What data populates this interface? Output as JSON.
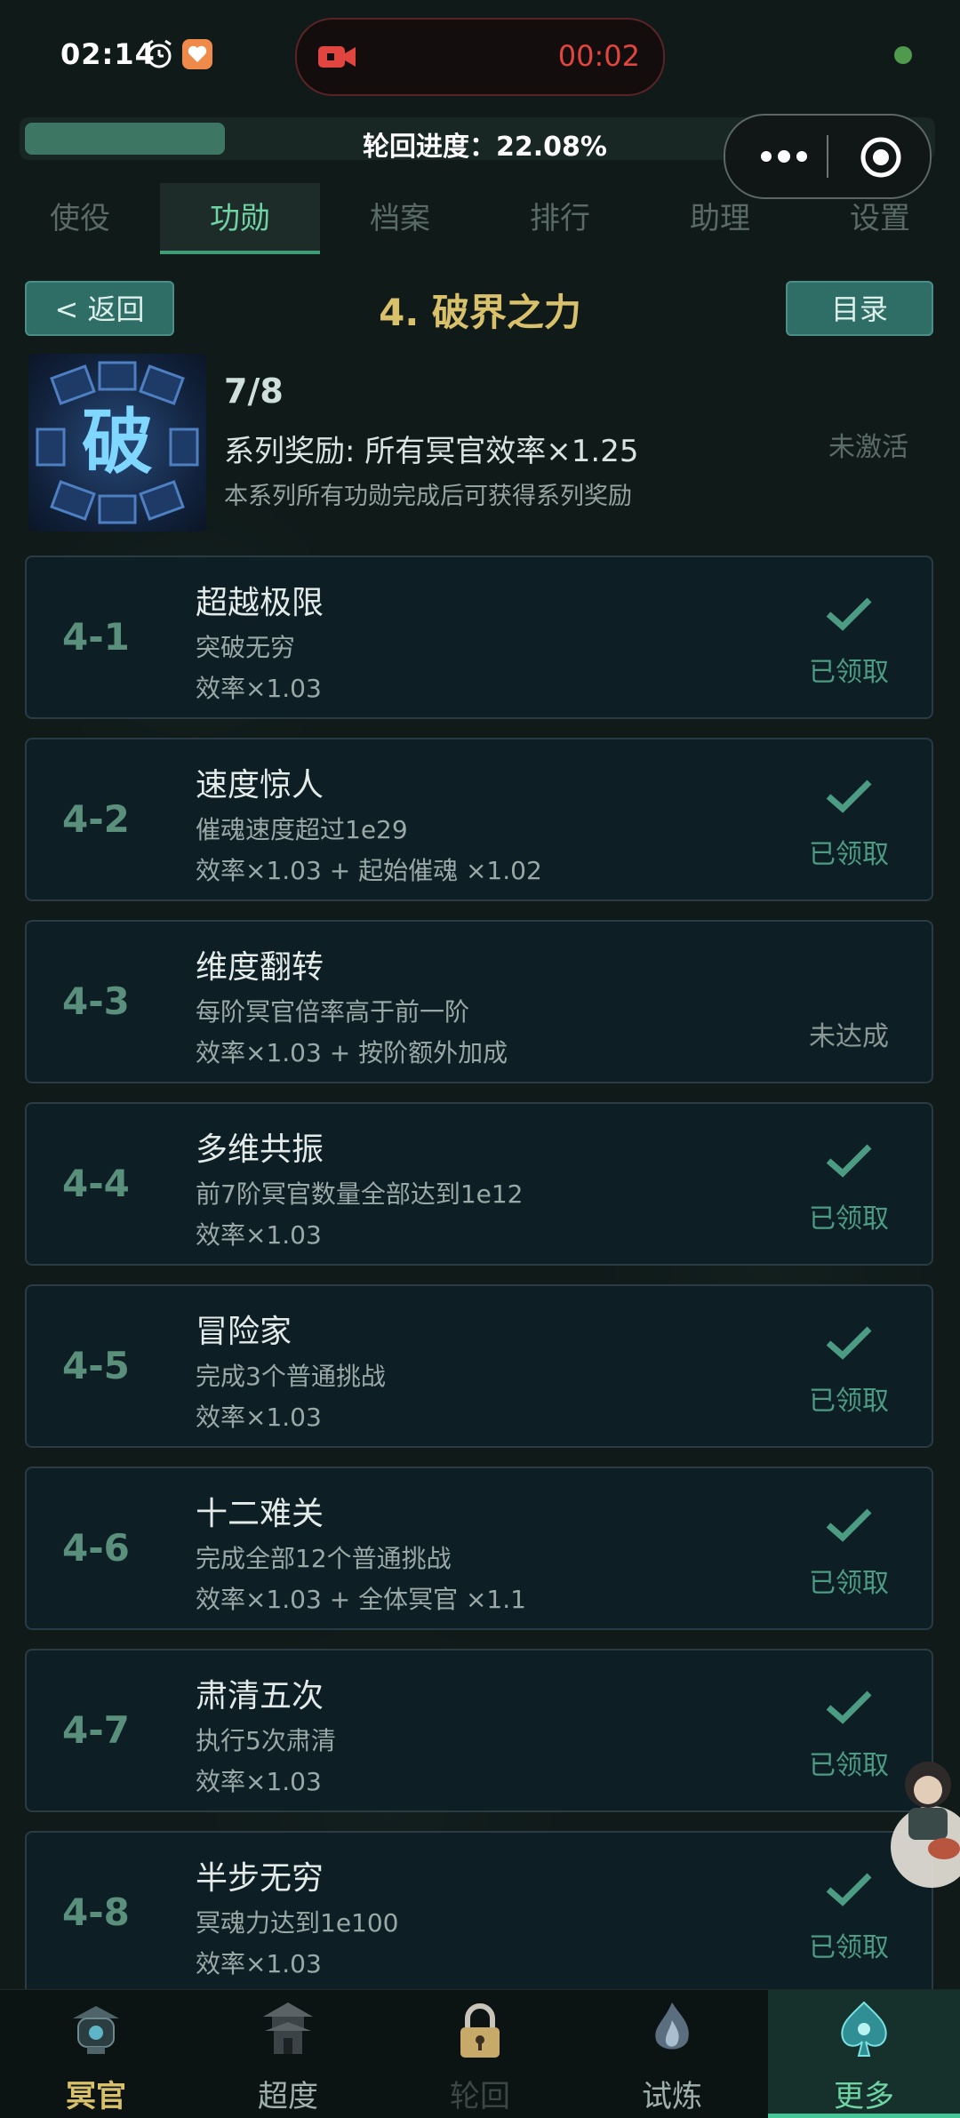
{
  "status_bar": {
    "time": "02:14",
    "record_time": "00:02"
  },
  "progress": {
    "label": "轮回进度：22.08%",
    "value_percent": 22.08
  },
  "tabs": [
    {
      "label": "使役"
    },
    {
      "label": "功勋"
    },
    {
      "label": "档案"
    },
    {
      "label": "排行"
    },
    {
      "label": "助理"
    },
    {
      "label": "设置"
    }
  ],
  "active_tab": "功勋",
  "header": {
    "back_label": "< 返回",
    "title": "4. 破界之力",
    "catalog_label": "目录"
  },
  "series": {
    "glyph": "破",
    "progress": "7/8",
    "reward": "系列奖励: 所有冥官效率×1.25",
    "description": "本系列所有功勋完成后可获得系列奖励",
    "status": "未激活"
  },
  "achievements": [
    {
      "id": "4-1",
      "title": "超越极限",
      "desc": "突破无穷",
      "effect": "效率×1.03",
      "status": "已领取",
      "claimed": true
    },
    {
      "id": "4-2",
      "title": "速度惊人",
      "desc": "催魂速度超过1e29",
      "effect": "效率×1.03 + 起始催魂 ×1.02",
      "status": "已领取",
      "claimed": true
    },
    {
      "id": "4-3",
      "title": "维度翻转",
      "desc": "每阶冥官倍率高于前一阶",
      "effect": "效率×1.03 + 按阶额外加成",
      "status": "未达成",
      "claimed": false
    },
    {
      "id": "4-4",
      "title": "多维共振",
      "desc": "前7阶冥官数量全部达到1e12",
      "effect": "效率×1.03",
      "status": "已领取",
      "claimed": true
    },
    {
      "id": "4-5",
      "title": "冒险家",
      "desc": "完成3个普通挑战",
      "effect": "效率×1.03",
      "status": "已领取",
      "claimed": true
    },
    {
      "id": "4-6",
      "title": "十二难关",
      "desc": "完成全部12个普通挑战",
      "effect": "效率×1.03 + 全体冥官 ×1.1",
      "status": "已领取",
      "claimed": true
    },
    {
      "id": "4-7",
      "title": "肃清五次",
      "desc": "执行5次肃清",
      "effect": "效率×1.03",
      "status": "已领取",
      "claimed": true
    },
    {
      "id": "4-8",
      "title": "半步无穷",
      "desc": "冥魂力达到1e100",
      "effect": "效率×1.03",
      "status": "已领取",
      "claimed": true
    }
  ],
  "bottom_nav": [
    {
      "label": "冥官",
      "icon": "lantern-icon"
    },
    {
      "label": "超度",
      "icon": "pagoda-icon"
    },
    {
      "label": "轮回",
      "icon": "lock-icon",
      "locked": true
    },
    {
      "label": "试炼",
      "icon": "flame-icon"
    },
    {
      "label": "更多",
      "icon": "spade-icon",
      "active": true
    }
  ],
  "colors": {
    "accent": "#6fd3a4",
    "title_gold": "#d8c16a",
    "button": "#2f6e66",
    "claimed_green": "#4c9c83"
  }
}
